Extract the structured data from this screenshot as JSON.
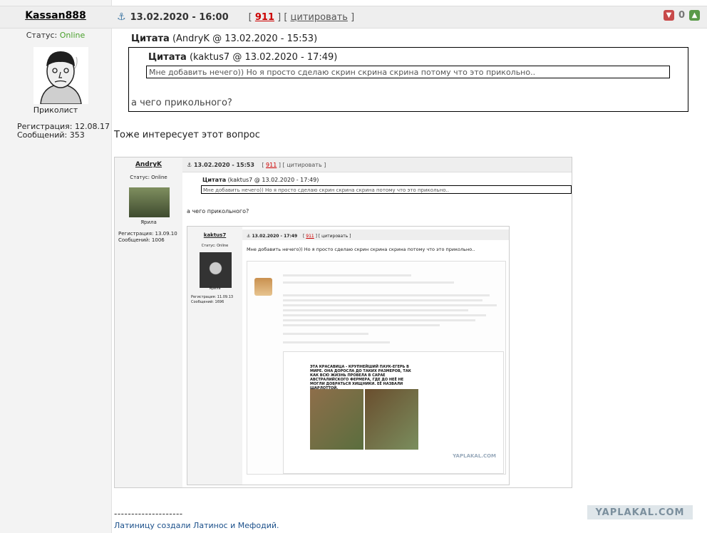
{
  "author": {
    "username": "Kassan888",
    "status_label": "Статус:",
    "status_value": "Online",
    "rank": "Приколист",
    "reg_label": "Регистрация: 12.08.17",
    "posts_label": "Сообщений: 353"
  },
  "post_meta": {
    "datetime": "13.02.2020 - 16:00",
    "post_number": "911",
    "quote_link": "цитировать",
    "rating": "0"
  },
  "quote1": {
    "label": "Цитата",
    "source": "(AndryK @ 13.02.2020 - 15:53)",
    "text": "а чего прикольного?"
  },
  "quote2": {
    "label": "Цитата",
    "source": "(kaktus7 @ 13.02.2020 - 17:49)",
    "text": "Мне добавить нечего)) Но я просто сделаю скрин скрина скрина потому что это прикольно.."
  },
  "reply_text": "Тоже интересует этот вопрос",
  "screenshot1": {
    "username": "AndryK",
    "status": "Статус: Online",
    "rank": "Ярила",
    "reg": "Регистрация: 13.09.10",
    "posts": "Сообщений: 1006",
    "datetime": "13.02.2020 - 15:53",
    "post_number": "911",
    "quote_link": "цитировать",
    "quote_label": "Цитата",
    "quote_source": "(kaktus7 @ 13.02.2020 - 17:49)",
    "quote_text": "Мне добавить нечего)) Но я просто сделаю скрин скрина скрина потому что это прикольно..",
    "text": "а чего прикольного?"
  },
  "screenshot2": {
    "username": "kaktus7",
    "status": "Статус: Online",
    "rank": "Ярила",
    "reg": "Регистрация: 11.09.13",
    "posts": "Сообщений: 1696",
    "datetime": "13.02.2020 - 17:49",
    "post_number": "911",
    "quote_link": "цитировать",
    "text": "Мне добавить нечего)) Но я просто сделаю скрин скрина скрина потому что это прикольно.."
  },
  "screenshot3": {
    "spider_caption": "ЭТА КРАСАВИЦА - КРУПНЕЙШИЙ ПАУК-ЕГЕРЬ В МИРЕ. ОНА ДОРОСЛА ДО ТАКИХ РАЗМЕРОВ, ТАК КАК ВСЮ ЖИЗНЬ ПРОВЕЛА В САРАЕ АВСТРАЛИЙСКОГО ФЕРМЕРА, ГДЕ ДО НЕЁ НЕ МОГЛИ ДОБРАТЬСЯ ХИЩНИКИ. ЕЁ НАЗВАЛИ ШАРЛОТТОЙ.",
    "watermark": "YAPLAKAL.COM"
  },
  "signature": {
    "separator": "--------------------",
    "text": "Латиницу создали Латинос и Мефодий."
  },
  "watermark": "YAPLAKAL.COM"
}
